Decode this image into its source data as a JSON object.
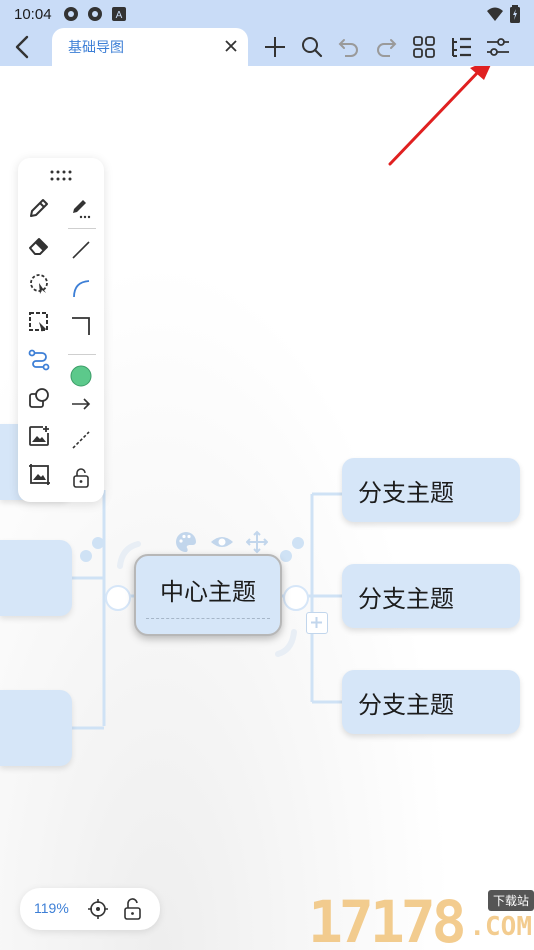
{
  "status_bar": {
    "time": "10:04",
    "icons": [
      "notification-icon",
      "notification-icon",
      "app-a-icon",
      "wifi-icon",
      "battery-icon"
    ]
  },
  "toolbar": {
    "tab_title": "基础导图",
    "icons": [
      "back-icon",
      "close-icon",
      "add-icon",
      "search-icon",
      "undo-icon",
      "redo-icon",
      "grid-icon",
      "outline-icon",
      "settings-sliders-icon"
    ]
  },
  "palette": {
    "tools": [
      "pencil-icon",
      "marker-icon",
      "eraser-icon",
      "line-icon",
      "lasso-icon",
      "arc-icon",
      "select-box-icon",
      "corner-line-icon",
      "connector-icon",
      "color-swatch",
      "shape-icon",
      "arrow-icon",
      "image-add-icon",
      "dashed-line-icon",
      "image-icon",
      "lock-icon"
    ],
    "swatch_color": "#5cc98b",
    "accent_color": "#3d7fd6"
  },
  "mindmap": {
    "center_topic": "中心主题",
    "branches": [
      "分支主题",
      "分支主题",
      "分支主题"
    ],
    "node_color": "#d6e6f8",
    "connector_color": "#cfe2f5"
  },
  "zoom": {
    "level": "119%"
  },
  "watermark": {
    "digits": "17178",
    "site_label": "下载站",
    "domain": ".COM"
  },
  "annotation": {
    "arrow_color": "#e02020"
  }
}
